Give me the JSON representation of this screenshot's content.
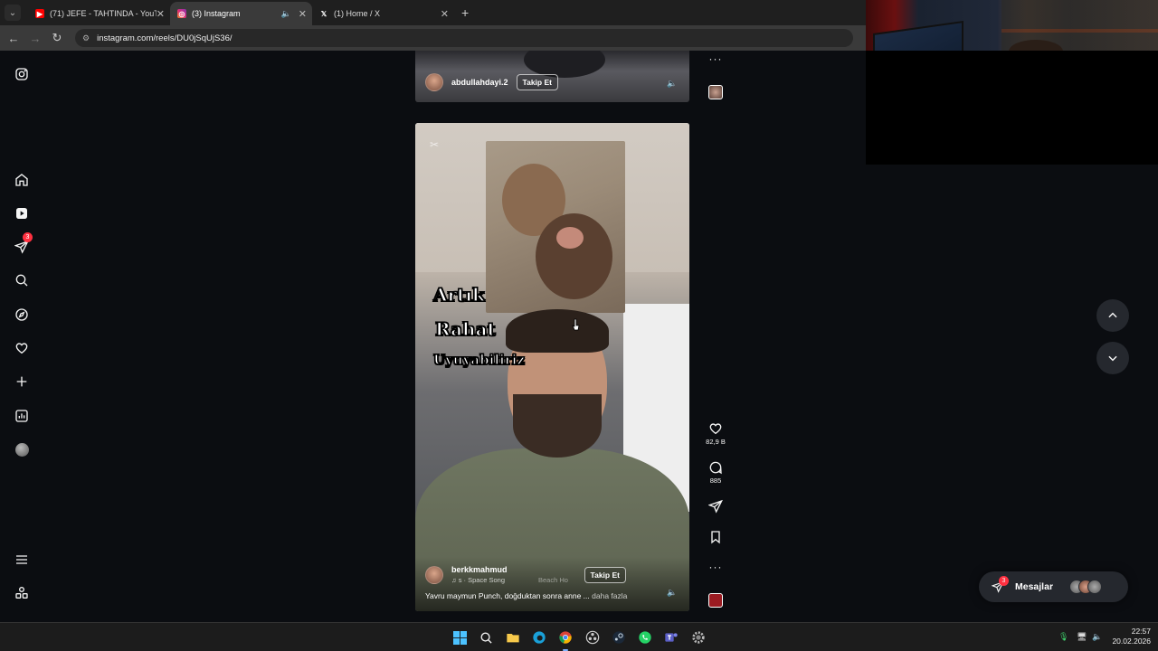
{
  "browser": {
    "tabs": [
      {
        "title": "(71) JEFE - TAHTINDA - YouTube",
        "favicon": "youtube-icon",
        "color": "#ff0000",
        "active": false
      },
      {
        "title": "(3) Instagram",
        "favicon": "instagram-icon",
        "color": "#e1306c",
        "active": true
      },
      {
        "title": "(1) Home / X",
        "favicon": "x-icon",
        "color": "#ffffff",
        "active": false
      }
    ],
    "new_tab": "+",
    "url": "instagram.com/reels/DU0jSqUjS36/"
  },
  "sidebar": {
    "items": [
      {
        "name": "instagram-logo-icon"
      },
      {
        "name": "home-icon"
      },
      {
        "name": "reels-icon"
      },
      {
        "name": "direct-messages-icon",
        "badge": "3"
      },
      {
        "name": "search-icon"
      },
      {
        "name": "explore-icon"
      },
      {
        "name": "notifications-heart-icon"
      },
      {
        "name": "create-plus-icon"
      },
      {
        "name": "dashboard-icon"
      },
      {
        "name": "profile-avatar"
      },
      {
        "name": "more-menu-icon"
      },
      {
        "name": "also-from-meta-icon"
      }
    ]
  },
  "reels": {
    "previous": {
      "username": "abdullahdayi.2",
      "follow_label": "Takip Et"
    },
    "current": {
      "overlay_text": [
        "Artık",
        "Rahat",
        "Uyuyabiliriz"
      ],
      "username": "berkkmahmud",
      "follow_label": "Takip Et",
      "song": "♫ s · Space Song",
      "song2": "Beach Ho",
      "description": "Yavru maymun Punch, doğduktan sonra anne ...",
      "more_label": "daha fazla",
      "likes": "82,9 B",
      "comments": "885"
    }
  },
  "messages": {
    "label": "Mesajlar",
    "badge": "3"
  },
  "taskbar": {
    "time": "22:57",
    "date": "20.02.2026"
  },
  "colors": {
    "accent_red": "#ff3040",
    "page_bg": "#0b0d11",
    "panel_bg": "#25282e"
  }
}
